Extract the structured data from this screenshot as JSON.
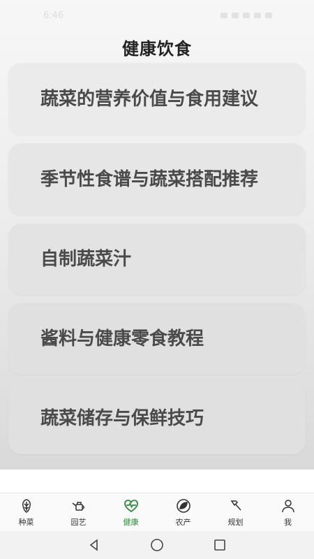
{
  "status_bar": {
    "time": "6:46"
  },
  "header": {
    "title": "健康饮食"
  },
  "cards": [
    {
      "label": "蔬菜的营养价值与食用建议"
    },
    {
      "label": "季节性食谱与蔬菜搭配推荐"
    },
    {
      "label": "自制蔬菜汁"
    },
    {
      "label": "酱料与健康零食教程"
    },
    {
      "label": "蔬菜储存与保鲜技巧"
    }
  ],
  "tabs": [
    {
      "label": "种菜",
      "icon": "vegetable-icon"
    },
    {
      "label": "园艺",
      "icon": "watering-can-icon"
    },
    {
      "label": "健康",
      "icon": "heart-pulse-icon",
      "active": true
    },
    {
      "label": "农产",
      "icon": "leaf-circle-icon"
    },
    {
      "label": "规划",
      "icon": "hammer-icon"
    },
    {
      "label": "我",
      "icon": "person-icon"
    }
  ],
  "colors": {
    "active": "#2e8b3a",
    "card": "#e9e9e9",
    "text": "#4a4a4a"
  }
}
